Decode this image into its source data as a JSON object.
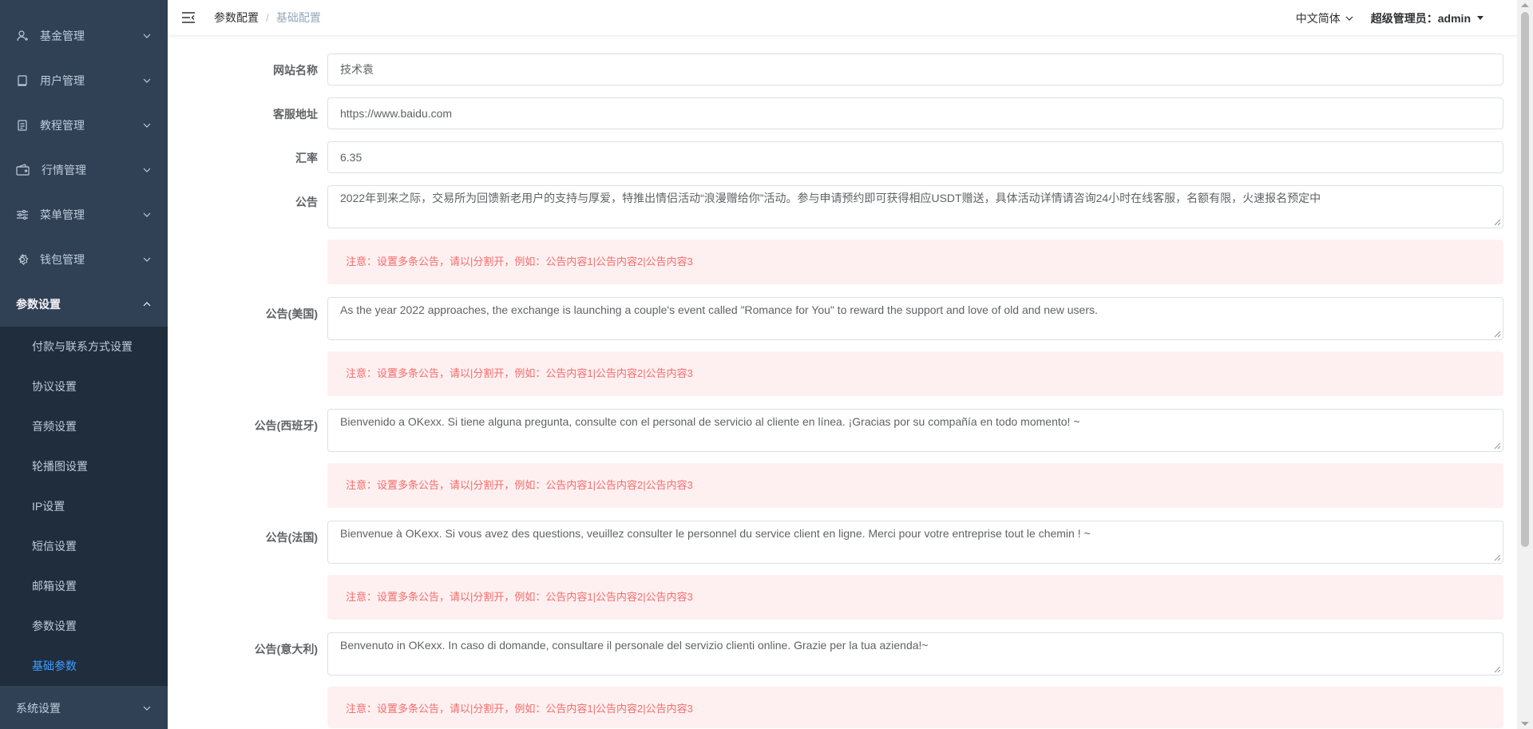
{
  "sidebar": {
    "items_top": [
      {
        "label": "基金管理",
        "icon": "user-icon"
      },
      {
        "label": "用户管理",
        "icon": "book-icon"
      },
      {
        "label": "教程管理",
        "icon": "document-icon"
      },
      {
        "label": "行情管理",
        "icon": "wallet-icon"
      },
      {
        "label": "菜单管理",
        "icon": "sliders-icon"
      },
      {
        "label": "钱包管理",
        "icon": "gear-icon"
      }
    ],
    "open_group": {
      "label": "参数设置"
    },
    "sub_items": [
      {
        "label": "付款与联系方式设置"
      },
      {
        "label": "协议设置"
      },
      {
        "label": "音频设置"
      },
      {
        "label": "轮播图设置"
      },
      {
        "label": "IP设置"
      },
      {
        "label": "短信设置"
      },
      {
        "label": "邮箱设置"
      },
      {
        "label": "参数设置"
      },
      {
        "label": "基础参数"
      }
    ],
    "active_sub": "基础参数",
    "bottom_item": {
      "label": "系统设置"
    }
  },
  "navbar": {
    "breadcrumb": {
      "parent": "参数配置",
      "separator": "/",
      "current": "基础配置"
    },
    "language": "中文简体",
    "user": "超级管理员：admin"
  },
  "form": {
    "site_name": {
      "label": "网站名称",
      "value": "技术袁"
    },
    "service_url": {
      "label": "客服地址",
      "value": "https://www.baidu.com"
    },
    "rate": {
      "label": "汇率",
      "value": "6.35"
    },
    "notice_text": "注意：设置多条公告，请以|分割开，例如：公告内容1|公告内容2|公告内容3",
    "announcements": [
      {
        "label": "公告",
        "value": "2022年到来之际，交易所为回馈新老用户的支持与厚爱，特推出情侣活动“浪漫赠给你”活动。参与申请预约即可获得相应USDT赠送，具体活动详情请咨询24小时在线客服，名额有限，火速报名预定中"
      },
      {
        "label": "公告(美国)",
        "value": "As the year 2022 approaches, the exchange is launching a couple's event called \"Romance for You\" to reward the support and love of old and new users."
      },
      {
        "label": "公告(西班牙)",
        "value": "Bienvenido a OKexx. Si tiene alguna pregunta, consulte con el personal de servicio al cliente en línea. ¡Gracias por su compañía en todo momento! ~"
      },
      {
        "label": "公告(法国)",
        "value": "Bienvenue à OKexx. Si vous avez des questions, veuillez consulter le personnel du service client en ligne. Merci pour votre entreprise tout le chemin ! ~"
      },
      {
        "label": "公告(意大利)",
        "value": "Benvenuto in OKexx. In caso di domande, consultare il personale del servizio clienti online. Grazie per la tua azienda!~"
      }
    ]
  },
  "colors": {
    "sidebar_bg": "#304156",
    "submenu_bg": "#1f2d3d",
    "accent": "#409eff",
    "notice_bg": "#fef0f0",
    "notice_text": "#f56c6c"
  }
}
